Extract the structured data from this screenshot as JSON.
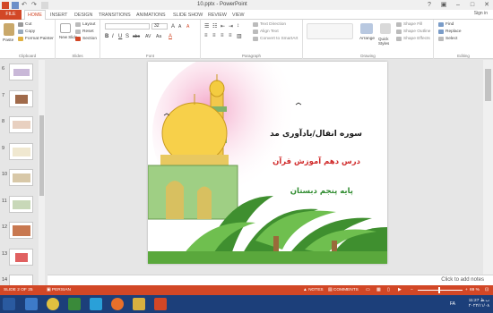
{
  "window": {
    "title": "10.pptx - PowerPoint"
  },
  "tabs": {
    "file": "FILE",
    "home": "HOME",
    "insert": "INSERT",
    "design": "DESIGN",
    "transitions": "TRANSITIONS",
    "animations": "ANIMATIONS",
    "slideshow": "SLIDE SHOW",
    "review": "REVIEW",
    "view": "VIEW",
    "signin": "Sign in"
  },
  "ribbon": {
    "clipboard": {
      "label": "Clipboard",
      "paste": "Paste",
      "cut": "Cut",
      "copy": "Copy",
      "format_painter": "Format Painter"
    },
    "slides": {
      "label": "Slides",
      "new_slide": "New Slide",
      "layout": "Layout",
      "reset": "Reset",
      "section": "Section"
    },
    "font": {
      "label": "Font",
      "size": "32"
    },
    "paragraph": {
      "label": "Paragraph",
      "text_direction": "Text Direction",
      "align_text": "Align Text",
      "smartart": "Convert to SmartArt"
    },
    "drawing": {
      "label": "Drawing",
      "arrange": "Arrange",
      "quick_styles": "Quick Styles",
      "shape_fill": "Shape Fill",
      "shape_outline": "Shape Outline",
      "shape_effects": "Shape Effects"
    },
    "editing": {
      "label": "Editing",
      "find": "Find",
      "replace": "Replace",
      "select": "Select"
    }
  },
  "thumbnails": [
    {
      "num": "6"
    },
    {
      "num": "7"
    },
    {
      "num": "8"
    },
    {
      "num": "9"
    },
    {
      "num": "10"
    },
    {
      "num": "11"
    },
    {
      "num": "12"
    },
    {
      "num": "13"
    },
    {
      "num": "14"
    }
  ],
  "slide": {
    "line1": "سوره انفال/یادآوری مد",
    "line2": "درس دهم آموزش قرآن",
    "line3": "پایه پنجم دبستان"
  },
  "notes": {
    "placeholder": "Click to add notes"
  },
  "status": {
    "slide_of": "SLIDE 2 OF 25",
    "language": "PERSIAN",
    "notes": "NOTES",
    "comments": "COMMENTS",
    "zoom": "69 %"
  },
  "tray": {
    "lang": "FA",
    "time": "11:27 ب.ظ",
    "date": "۲۰۲۲/۱۱/۰۸"
  },
  "colors": {
    "accent": "#d24726",
    "taskbar": "#1c3f7a",
    "title_text": "#1a1a1a",
    "red_text": "#d02a2a",
    "green_text": "#2e8b2e"
  }
}
